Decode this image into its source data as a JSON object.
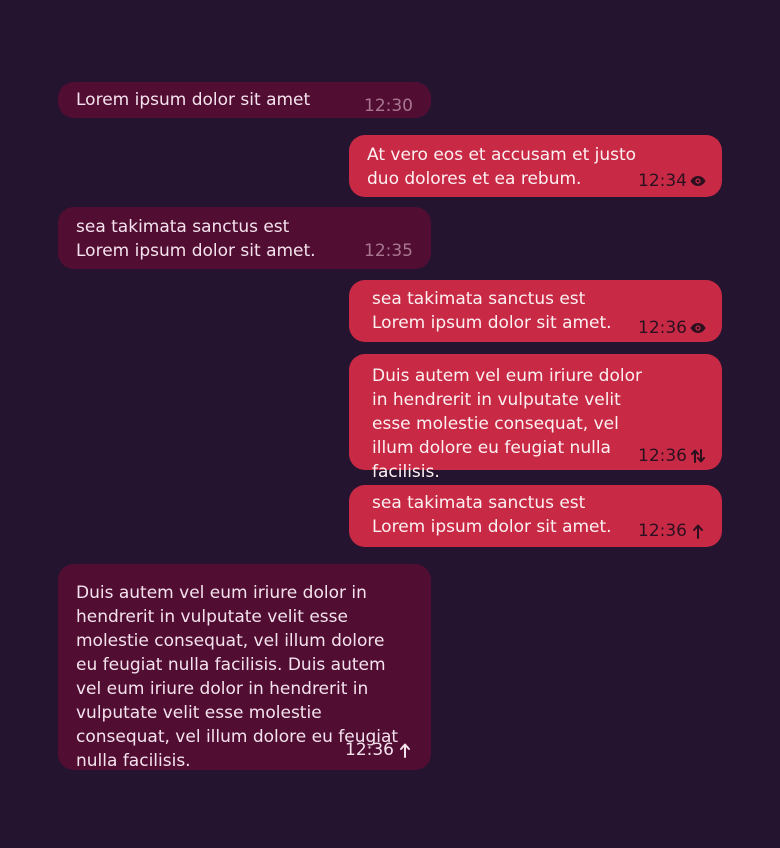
{
  "messages": [
    {
      "text": "Lorem ipsum dolor sit amet",
      "time": "12:30",
      "status_icon": ""
    },
    {
      "text": "At vero eos et accusam et justo duo dolores et ea rebum.",
      "time": "12:34",
      "status_icon": "eye-icon"
    },
    {
      "text": "sea takimata sanctus est Lorem ipsum dolor sit amet.",
      "time": "12:35",
      "status_icon": ""
    },
    {
      "text": "sea takimata sanctus est Lorem ipsum dolor sit amet.",
      "time": "12:36",
      "status_icon": "eye-icon"
    },
    {
      "text": "Duis autem vel eum iriure dolor in hendrerit in vulputate velit esse molestie consequat, vel illum dolore eu feugiat nulla facilisis.",
      "time": "12:36",
      "status_icon": "transfer-arrows-icon"
    },
    {
      "text": "sea takimata sanctus est Lorem ipsum dolor sit amet.",
      "time": "12:36",
      "status_icon": "arrow-up-icon"
    },
    {
      "text": "Duis autem vel eum iriure dolor in hendrerit in vulputate velit esse molestie consequat, vel illum dolore eu feugiat nulla facilisis. Duis autem vel eum iriure dolor in hendrerit in vulputate velit esse molestie consequat, vel illum dolore eu feugiat nulla facilisis.",
      "time": "12:36",
      "status_icon": "arrow-up-icon"
    }
  ],
  "colors": {
    "background": "#241430",
    "incoming_bubble": "#520d33",
    "outgoing_bubble": "#c82a45"
  }
}
